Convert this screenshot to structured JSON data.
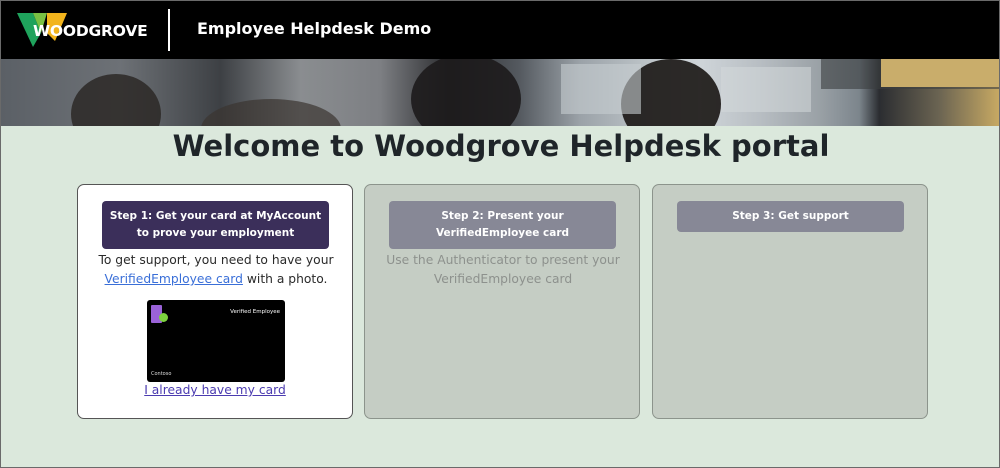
{
  "header": {
    "logo_text": "WOODGROVE",
    "app_title": "Employee Helpdesk Demo"
  },
  "main": {
    "welcome_heading": "Welcome to Woodgrove Helpdesk portal"
  },
  "steps": [
    {
      "button_line1": "Step 1: Get your card at MyAccount",
      "button_line2": "to prove your employment",
      "desc_before": "To get support, you need to have your",
      "desc_link": "VerifiedEmployee card",
      "desc_after": "with a photo.",
      "card_title": "Verified Employee",
      "card_org": "Contoso",
      "have_card_link": "I already have my card"
    },
    {
      "button_line1": "Step 2: Present your",
      "button_line2": "VerifiedEmployee card",
      "desc_line1": "Use the Authenticator to present your",
      "desc_line2": "VerifiedEmployee card"
    },
    {
      "button_label": "Step 3: Get support"
    }
  ],
  "colors": {
    "page_bg": "#dbe8dc",
    "topbar_bg": "#000000",
    "primary_button": "#3b2f5a",
    "muted_button": "#878896",
    "inactive_card": "#c5cdc4",
    "link": "#3a6fd8"
  }
}
